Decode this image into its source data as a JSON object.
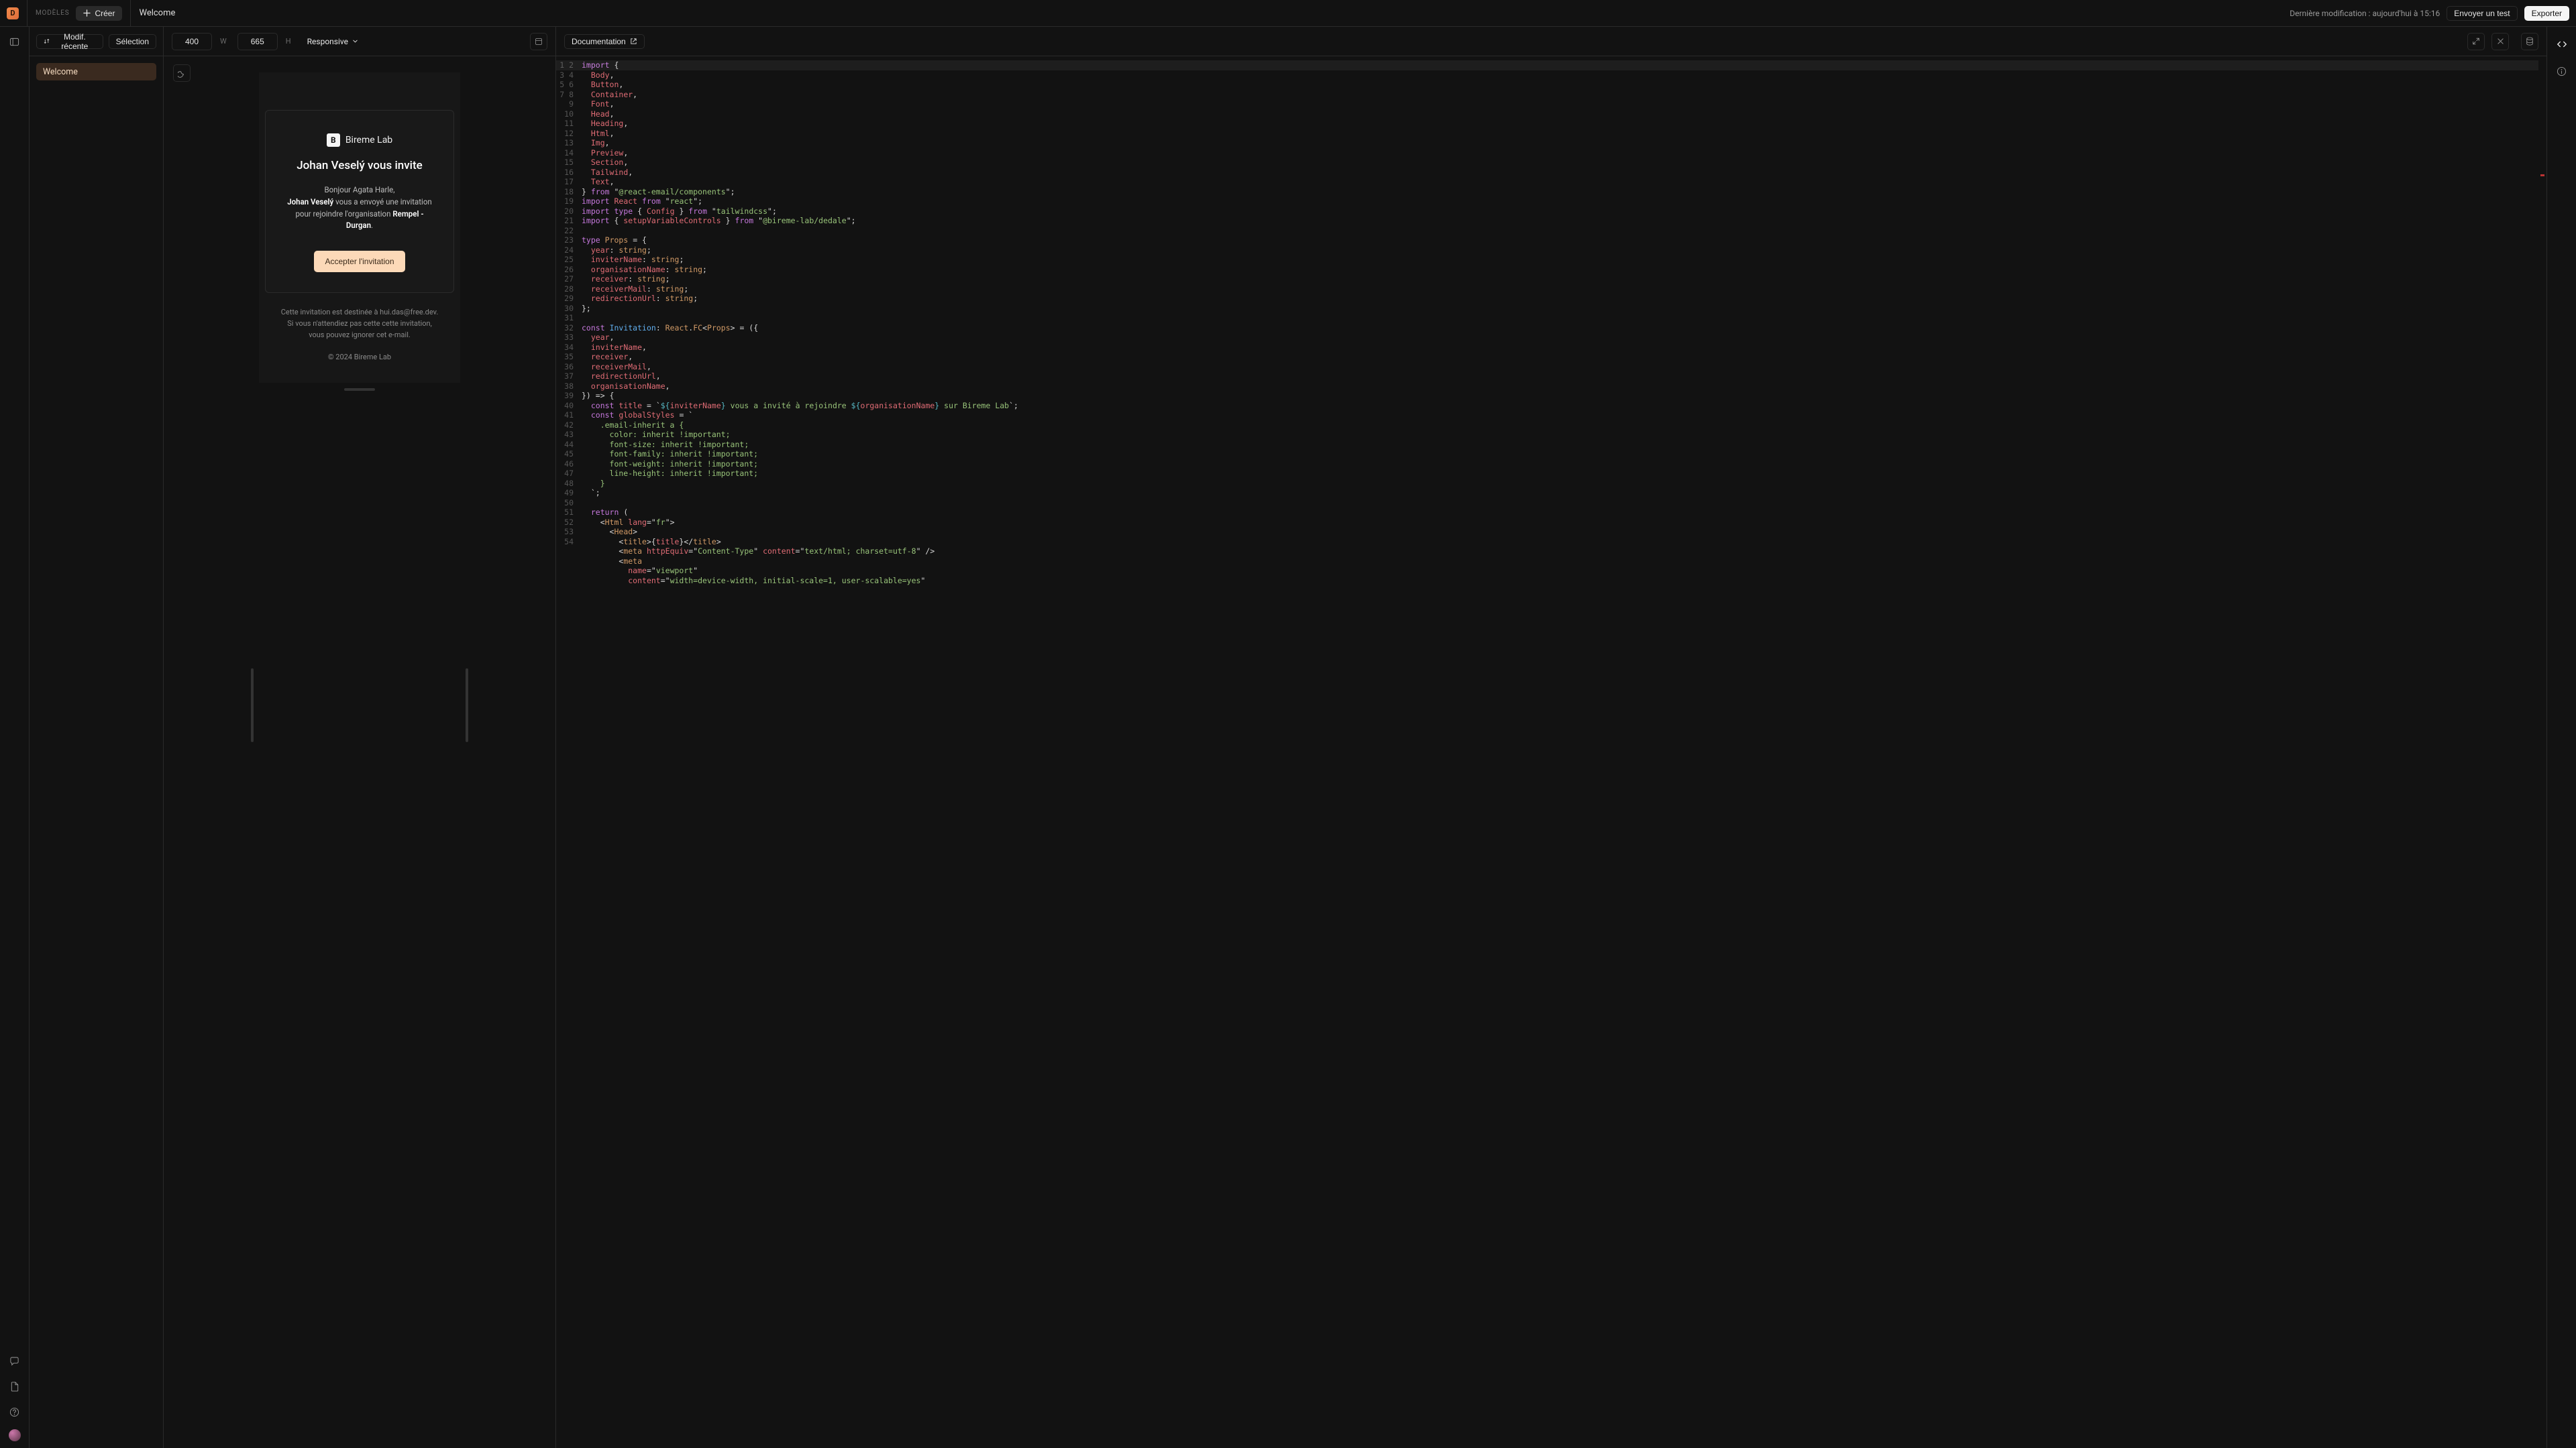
{
  "topbar": {
    "models_label": "MODÈLES",
    "create_label": "Créer",
    "tab_title": "Welcome",
    "status": "Dernière modification : aujourd'hui à 15:16",
    "send_test": "Envoyer un test",
    "export": "Exporter",
    "logo_letter": "D"
  },
  "sidebar": {
    "recent_mod": "Modif. récente",
    "selection": "Sélection",
    "items": [
      {
        "label": "Welcome",
        "active": true
      }
    ]
  },
  "preview": {
    "width": "400",
    "height": "665",
    "w_label": "W",
    "h_label": "H",
    "responsive": "Responsive"
  },
  "email": {
    "brand_letter": "B",
    "brand_name": "Bireme Lab",
    "title": "Johan Veselý vous invite",
    "greeting": "Bonjour Agata Harle,",
    "inviter": "Johan Veselý",
    "body_mid": " vous a envoyé une invitation",
    "body_line2a": "pour rejoindre l'organisation ",
    "org": "Rempel - Durgan",
    "period": ".",
    "cta": "Accepter l'invitation",
    "footer_l1": "Cette invitation est destinée à hui.das@free.dev.",
    "footer_l2": "Si vous n'attendiez pas cette cette invitation,",
    "footer_l3": "vous pouvez ignorer cet e-mail.",
    "copyright": "© 2024 Bireme Lab"
  },
  "code_toolbar": {
    "documentation": "Documentation"
  },
  "code": {
    "line_count": 54,
    "lines": [
      {
        "t": "import {",
        "c": [
          [
            "kw",
            "import"
          ],
          [
            "pun",
            " {"
          ]
        ]
      },
      {
        "t": "  Body,",
        "c": [
          [
            "pun",
            "  "
          ],
          [
            "id",
            "Body"
          ],
          [
            "pun",
            ","
          ]
        ]
      },
      {
        "t": "  Button,",
        "c": [
          [
            "pun",
            "  "
          ],
          [
            "id",
            "Button"
          ],
          [
            "pun",
            ","
          ]
        ]
      },
      {
        "t": "  Container,",
        "c": [
          [
            "pun",
            "  "
          ],
          [
            "id",
            "Container"
          ],
          [
            "pun",
            ","
          ]
        ]
      },
      {
        "t": "  Font,",
        "c": [
          [
            "pun",
            "  "
          ],
          [
            "id",
            "Font"
          ],
          [
            "pun",
            ","
          ]
        ]
      },
      {
        "t": "  Head,",
        "c": [
          [
            "pun",
            "  "
          ],
          [
            "id",
            "Head"
          ],
          [
            "pun",
            ","
          ]
        ]
      },
      {
        "t": "  Heading,",
        "c": [
          [
            "pun",
            "  "
          ],
          [
            "id",
            "Heading"
          ],
          [
            "pun",
            ","
          ]
        ]
      },
      {
        "t": "  Html,",
        "c": [
          [
            "pun",
            "  "
          ],
          [
            "id",
            "Html"
          ],
          [
            "pun",
            ","
          ]
        ]
      },
      {
        "t": "  Img,",
        "c": [
          [
            "pun",
            "  "
          ],
          [
            "id",
            "Img"
          ],
          [
            "pun",
            ","
          ]
        ]
      },
      {
        "t": "  Preview,",
        "c": [
          [
            "pun",
            "  "
          ],
          [
            "id",
            "Preview"
          ],
          [
            "pun",
            ","
          ]
        ]
      },
      {
        "t": "  Section,",
        "c": [
          [
            "pun",
            "  "
          ],
          [
            "id",
            "Section"
          ],
          [
            "pun",
            ","
          ]
        ]
      },
      {
        "t": "  Tailwind,",
        "c": [
          [
            "pun",
            "  "
          ],
          [
            "id",
            "Tailwind"
          ],
          [
            "pun",
            ","
          ]
        ]
      },
      {
        "t": "  Text,",
        "c": [
          [
            "pun",
            "  "
          ],
          [
            "id",
            "Text"
          ],
          [
            "pun",
            ","
          ]
        ]
      },
      {
        "t": "} from \"@react-email/components\";",
        "c": [
          [
            "pun",
            "} "
          ],
          [
            "kw",
            "from"
          ],
          [
            "pun",
            " \""
          ],
          [
            "lib",
            "@react-email/components"
          ],
          [
            "pun",
            "\";"
          ]
        ]
      },
      {
        "t": "import React from \"react\";",
        "c": [
          [
            "kw",
            "import"
          ],
          [
            "pun",
            " "
          ],
          [
            "id",
            "React"
          ],
          [
            "pun",
            " "
          ],
          [
            "kw",
            "from"
          ],
          [
            "pun",
            " \""
          ],
          [
            "lib",
            "react"
          ],
          [
            "pun",
            "\";"
          ]
        ]
      },
      {
        "t": "import type { Config } from \"tailwindcss\";",
        "c": [
          [
            "kw",
            "import"
          ],
          [
            "pun",
            " "
          ],
          [
            "kw",
            "type"
          ],
          [
            "pun",
            " { "
          ],
          [
            "id",
            "Config"
          ],
          [
            "pun",
            " } "
          ],
          [
            "kw",
            "from"
          ],
          [
            "pun",
            " \""
          ],
          [
            "lib",
            "tailwindcss"
          ],
          [
            "pun",
            "\";"
          ]
        ]
      },
      {
        "t": "import { setupVariableControls } from \"@bireme-lab/dedale\";",
        "c": [
          [
            "kw",
            "import"
          ],
          [
            "pun",
            " { "
          ],
          [
            "id",
            "setupVariableControls"
          ],
          [
            "pun",
            " } "
          ],
          [
            "kw",
            "from"
          ],
          [
            "pun",
            " \""
          ],
          [
            "lib",
            "@bireme-lab/dedale"
          ],
          [
            "pun",
            "\";"
          ]
        ]
      },
      {
        "t": "",
        "c": [
          [
            "pun",
            ""
          ]
        ]
      },
      {
        "t": "type Props = {",
        "c": [
          [
            "kw",
            "type"
          ],
          [
            "pun",
            " "
          ],
          [
            "ty",
            "Props"
          ],
          [
            "pun",
            " = {"
          ]
        ]
      },
      {
        "t": "  year: string;",
        "c": [
          [
            "pun",
            "  "
          ],
          [
            "id",
            "year"
          ],
          [
            "pun",
            ": "
          ],
          [
            "ty",
            "string"
          ],
          [
            "pun",
            ";"
          ]
        ]
      },
      {
        "t": "  inviterName: string;",
        "c": [
          [
            "pun",
            "  "
          ],
          [
            "id",
            "inviterName"
          ],
          [
            "pun",
            ": "
          ],
          [
            "ty",
            "string"
          ],
          [
            "pun",
            ";"
          ]
        ]
      },
      {
        "t": "  organisationName: string;",
        "c": [
          [
            "pun",
            "  "
          ],
          [
            "id",
            "organisationName"
          ],
          [
            "pun",
            ": "
          ],
          [
            "ty",
            "string"
          ],
          [
            "pun",
            ";"
          ]
        ]
      },
      {
        "t": "  receiver: string;",
        "c": [
          [
            "pun",
            "  "
          ],
          [
            "id",
            "receiver"
          ],
          [
            "pun",
            ": "
          ],
          [
            "ty",
            "string"
          ],
          [
            "pun",
            ";"
          ]
        ]
      },
      {
        "t": "  receiverMail: string;",
        "c": [
          [
            "pun",
            "  "
          ],
          [
            "id",
            "receiverMail"
          ],
          [
            "pun",
            ": "
          ],
          [
            "ty",
            "string"
          ],
          [
            "pun",
            ";"
          ]
        ]
      },
      {
        "t": "  redirectionUrl: string;",
        "c": [
          [
            "pun",
            "  "
          ],
          [
            "id",
            "redirectionUrl"
          ],
          [
            "pun",
            ": "
          ],
          [
            "ty",
            "string"
          ],
          [
            "pun",
            ";"
          ]
        ]
      },
      {
        "t": "};",
        "c": [
          [
            "pun",
            "};"
          ]
        ]
      },
      {
        "t": "",
        "c": [
          [
            "pun",
            ""
          ]
        ]
      },
      {
        "t": "const Invitation: React.FC<Props> = ({",
        "c": [
          [
            "kw",
            "const"
          ],
          [
            "pun",
            " "
          ],
          [
            "fn",
            "Invitation"
          ],
          [
            "pun",
            ": "
          ],
          [
            "ty",
            "React"
          ],
          [
            "pun",
            "."
          ],
          [
            "ty",
            "FC"
          ],
          [
            "pun",
            "<"
          ],
          [
            "ty",
            "Props"
          ],
          [
            "pun",
            "> = ({"
          ]
        ]
      },
      {
        "t": "  year,",
        "c": [
          [
            "pun",
            "  "
          ],
          [
            "id",
            "year"
          ],
          [
            "pun",
            ","
          ]
        ]
      },
      {
        "t": "  inviterName,",
        "c": [
          [
            "pun",
            "  "
          ],
          [
            "id",
            "inviterName"
          ],
          [
            "pun",
            ","
          ]
        ]
      },
      {
        "t": "  receiver,",
        "c": [
          [
            "pun",
            "  "
          ],
          [
            "id",
            "receiver"
          ],
          [
            "pun",
            ","
          ]
        ]
      },
      {
        "t": "  receiverMail,",
        "c": [
          [
            "pun",
            "  "
          ],
          [
            "id",
            "receiverMail"
          ],
          [
            "pun",
            ","
          ]
        ]
      },
      {
        "t": "  redirectionUrl,",
        "c": [
          [
            "pun",
            "  "
          ],
          [
            "id",
            "redirectionUrl"
          ],
          [
            "pun",
            ","
          ]
        ]
      },
      {
        "t": "  organisationName,",
        "c": [
          [
            "pun",
            "  "
          ],
          [
            "id",
            "organisationName"
          ],
          [
            "pun",
            ","
          ]
        ]
      },
      {
        "t": "}) => {",
        "c": [
          [
            "pun",
            "}) => {"
          ]
        ]
      },
      {
        "t": "  const title = `${inviterName} vous a invité à rejoindre ${organisationName} sur Bireme Lab`;",
        "c": [
          [
            "pun",
            "  "
          ],
          [
            "kw",
            "const"
          ],
          [
            "pun",
            " "
          ],
          [
            "id",
            "title"
          ],
          [
            "pun",
            " = `"
          ],
          [
            "tpl",
            "${"
          ],
          [
            "id",
            "inviterName"
          ],
          [
            "tpl",
            "}"
          ],
          [
            "str",
            " vous a invité à rejoindre "
          ],
          [
            "tpl",
            "${"
          ],
          [
            "id",
            "organisationName"
          ],
          [
            "tpl",
            "}"
          ],
          [
            "str",
            " sur Bireme Lab"
          ],
          [
            "pun",
            "`;"
          ]
        ]
      },
      {
        "t": "  const globalStyles = `",
        "c": [
          [
            "pun",
            "  "
          ],
          [
            "kw",
            "const"
          ],
          [
            "pun",
            " "
          ],
          [
            "id",
            "globalStyles"
          ],
          [
            "pun",
            " = `"
          ]
        ]
      },
      {
        "t": "    .email-inherit a {",
        "c": [
          [
            "str",
            "    .email-inherit a {"
          ]
        ]
      },
      {
        "t": "      color: inherit !important;",
        "c": [
          [
            "str",
            "      color: inherit !important;"
          ]
        ]
      },
      {
        "t": "      font-size: inherit !important;",
        "c": [
          [
            "str",
            "      font-size: inherit !important;"
          ]
        ]
      },
      {
        "t": "      font-family: inherit !important;",
        "c": [
          [
            "str",
            "      font-family: inherit !important;"
          ]
        ]
      },
      {
        "t": "      font-weight: inherit !important;",
        "c": [
          [
            "str",
            "      font-weight: inherit !important;"
          ]
        ]
      },
      {
        "t": "      line-height: inherit !important;",
        "c": [
          [
            "str",
            "      line-height: inherit !important;"
          ]
        ]
      },
      {
        "t": "    }",
        "c": [
          [
            "str",
            "    }"
          ]
        ]
      },
      {
        "t": "  `;",
        "c": [
          [
            "pun",
            "  `;"
          ]
        ]
      },
      {
        "t": "",
        "c": [
          [
            "pun",
            ""
          ]
        ]
      },
      {
        "t": "  return (",
        "c": [
          [
            "pun",
            "  "
          ],
          [
            "kw",
            "return"
          ],
          [
            "pun",
            " ("
          ]
        ]
      },
      {
        "t": "    <Html lang=\"fr\">",
        "c": [
          [
            "pun",
            "    <"
          ],
          [
            "ty",
            "Html"
          ],
          [
            "pun",
            " "
          ],
          [
            "id",
            "lang"
          ],
          [
            "pun",
            "=\""
          ],
          [
            "str",
            "fr"
          ],
          [
            "pun",
            "\">"
          ]
        ]
      },
      {
        "t": "      <Head>",
        "c": [
          [
            "pun",
            "      <"
          ],
          [
            "ty",
            "Head"
          ],
          [
            "pun",
            ">"
          ]
        ]
      },
      {
        "t": "        <title>{title}</title>",
        "c": [
          [
            "pun",
            "        <"
          ],
          [
            "ty",
            "title"
          ],
          [
            "pun",
            ">{"
          ],
          [
            "id",
            "title"
          ],
          [
            "pun",
            "}</"
          ],
          [
            "ty",
            "title"
          ],
          [
            "pun",
            ">"
          ]
        ]
      },
      {
        "t": "        <meta httpEquiv=\"Content-Type\" content=\"text/html; charset=utf-8\" />",
        "c": [
          [
            "pun",
            "        <"
          ],
          [
            "ty",
            "meta"
          ],
          [
            "pun",
            " "
          ],
          [
            "id",
            "httpEquiv"
          ],
          [
            "pun",
            "=\""
          ],
          [
            "str",
            "Content-Type"
          ],
          [
            "pun",
            "\" "
          ],
          [
            "id",
            "content"
          ],
          [
            "pun",
            "=\""
          ],
          [
            "str",
            "text/html; charset=utf-8"
          ],
          [
            "pun",
            "\" />"
          ]
        ]
      },
      {
        "t": "        <meta",
        "c": [
          [
            "pun",
            "        <"
          ],
          [
            "ty",
            "meta"
          ]
        ]
      },
      {
        "t": "          name=\"viewport\"",
        "c": [
          [
            "pun",
            "          "
          ],
          [
            "id",
            "name"
          ],
          [
            "pun",
            "=\""
          ],
          [
            "str",
            "viewport"
          ],
          [
            "pun",
            "\""
          ]
        ]
      },
      {
        "t": "          content=\"width=device-width, initial-scale=1, user-scalable=yes\"",
        "c": [
          [
            "pun",
            "          "
          ],
          [
            "id",
            "content"
          ],
          [
            "pun",
            "=\""
          ],
          [
            "str",
            "width=device-width, initial-scale=1, user-scalable=yes"
          ],
          [
            "pun",
            "\""
          ]
        ]
      }
    ]
  }
}
